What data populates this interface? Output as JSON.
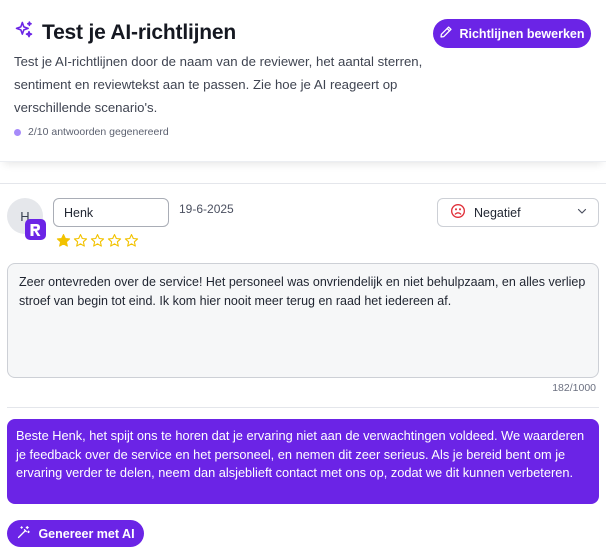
{
  "header": {
    "title": "Test je AI-richtlijnen",
    "title_icon": "sparkles-icon",
    "edit_button_label": "Richtlijnen bewerken",
    "description": "Test je AI-richtlijnen door de naam van de reviewer, het aantal sterren, sentiment en reviewtekst aan te passen. Zie hoe je AI reageert op verschillende scenario's.",
    "progress_text": "2/10 antwoorden gegenereerd"
  },
  "review": {
    "avatar_initial": "H",
    "reviewer_name": "Henk",
    "date": "19-6-2025",
    "rating": 1,
    "max_rating": 5,
    "sentiment": "Negatief",
    "text": "Zeer ontevreden over de service! Het personeel was onvriendelijk en niet behulpzaam, en alles verliep stroef van begin tot eind. Ik kom hier nooit meer terug en raad het iedereen af.",
    "char_count": "182/1000"
  },
  "ai_response": "Beste Henk, het spijt ons te horen dat je ervaring niet aan de verwachtingen voldeed. We waarderen je feedback over de service en het personeel, en nemen dit zeer serieus. Als je bereid bent om je ervaring verder te delen, neem dan alsjeblieft contact met ons op, zodat we dit kunnen verbeteren.",
  "generate_button_label": "Genereer met AI",
  "colors": {
    "accent": "#6b24e6",
    "star": "#f2c200",
    "negative": "#e0303a",
    "progress_dot": "#a78bfa"
  }
}
